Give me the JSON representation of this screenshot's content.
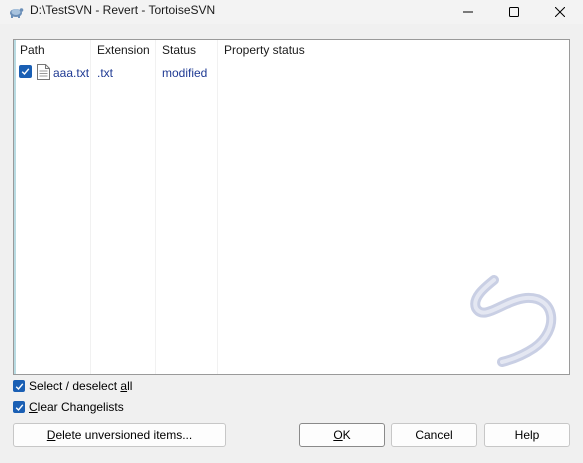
{
  "window": {
    "title": "D:\\TestSVN - Revert - TortoiseSVN",
    "icon": "tortoise-icon"
  },
  "titlebar_buttons": {
    "minimize_icon": "minimize-icon",
    "maximize_icon": "maximize-icon",
    "close_icon": "close-icon"
  },
  "list": {
    "columns": [
      "Path",
      "Extension",
      "Status",
      "Property status"
    ],
    "rows": [
      {
        "checked": true,
        "path": "aaa.txt",
        "extension": ".txt",
        "status": "modified",
        "property_status": ""
      }
    ]
  },
  "options": {
    "select_all": {
      "prefix": "Select / deselect ",
      "mnemonic": "a",
      "suffix": "ll",
      "checked": true
    },
    "clear_changelists": {
      "mnemonic": "C",
      "suffix": "lear Changelists",
      "checked": true
    }
  },
  "buttons": {
    "delete_unversioned": {
      "mnemonic": "D",
      "suffix": "elete unversioned items..."
    },
    "ok": {
      "mnemonic": "O",
      "suffix": "K"
    },
    "cancel": "Cancel",
    "help": "Help"
  },
  "colors": {
    "accent": "#1a5fb4",
    "list_text": "#1f3a93",
    "revert_art": "#c9cfe4"
  }
}
